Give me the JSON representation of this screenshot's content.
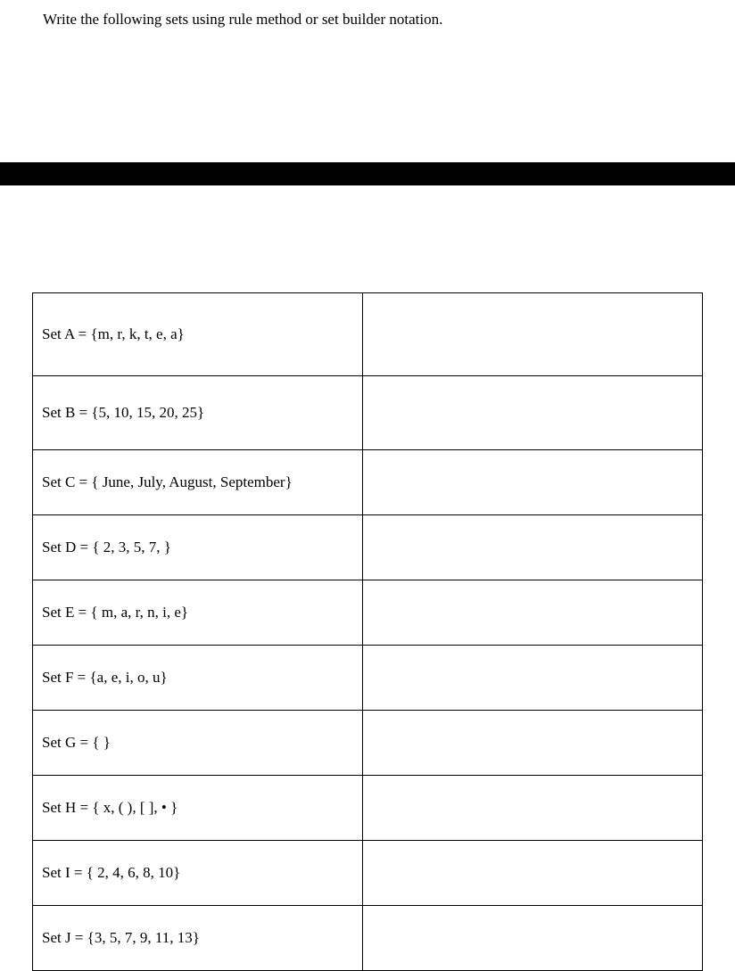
{
  "instruction": "Write the following sets using rule method or set builder notation.",
  "rows": [
    {
      "key": "a",
      "label": "Set A = {m, r,  k, t, e, a}"
    },
    {
      "key": "b",
      "label": "Set B = {5, 10, 15, 20, 25}"
    },
    {
      "key": "c",
      "label": "Set C = { June, July, August, September}"
    },
    {
      "key": "d",
      "label": "Set D = { 2, 3, 5, 7, }"
    },
    {
      "key": "e",
      "label": "Set E = { m, a, r, n, i, e}"
    },
    {
      "key": "f",
      "label": "Set F = {a, e, i, o, u}"
    },
    {
      "key": "g",
      "label": "Set G =  {   }"
    },
    {
      "key": "h",
      "label": "Set H = { x,  ( ), [  ], • }"
    },
    {
      "key": "i",
      "label": "Set I = { 2, 4, 6, 8, 10}"
    },
    {
      "key": "j",
      "label": "Set J = {3, 5, 7, 9, 11, 13}"
    }
  ]
}
